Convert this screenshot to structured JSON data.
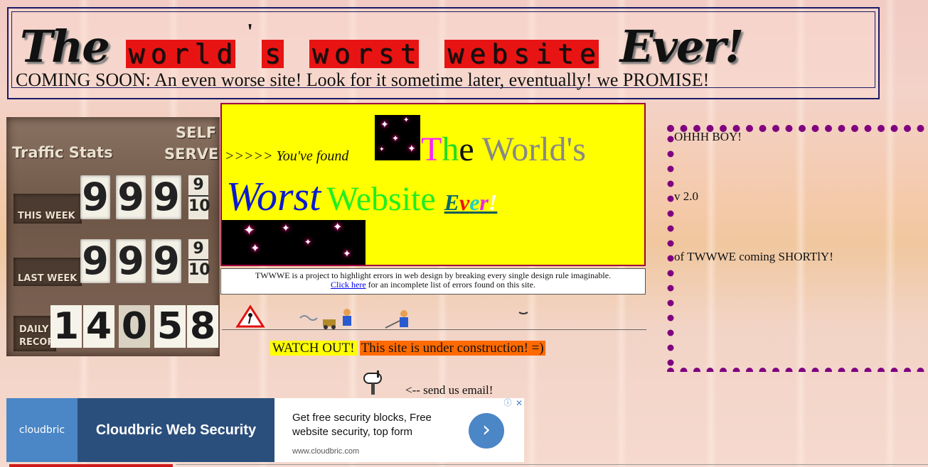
{
  "header": {
    "title_the": "The",
    "title_worlds_letters": [
      "w",
      "o",
      "r",
      "l",
      "d"
    ],
    "title_apostrophe": "'",
    "title_s": "s",
    "title_worst_letters": [
      "w",
      "o",
      "r",
      "s",
      "t"
    ],
    "title_website_letters": [
      "w",
      "e",
      "b",
      "s",
      "i",
      "t",
      "e"
    ],
    "title_ever": "Ever!",
    "coming_soon": "COMING SOON: An even worse site! Look for it sometime later, eventually!  we PROMISE!"
  },
  "traffic": {
    "title": "Traffic Stats",
    "self": "SELF",
    "serve": "SERVE",
    "this_week_label": "THIS WEEK",
    "this_week_digits": [
      "9",
      "9",
      "9"
    ],
    "last_week_label": "LAST WEEK",
    "last_week_digits": [
      "9",
      "9",
      "9"
    ],
    "frac_top": "9",
    "frac_bottom": "10",
    "daily_label_1": "DAILY",
    "daily_label_2": "RECOR",
    "daily_digits": [
      "1",
      "4",
      "0",
      "5",
      "8"
    ]
  },
  "banner": {
    "found": ">>>>> You've found",
    "the_letters": [
      {
        "ch": "T",
        "color": "#ff22ff"
      },
      {
        "ch": "h",
        "color": "#22dd22"
      },
      {
        "ch": "e",
        "color": "#111111"
      }
    ],
    "worlds": " World's",
    "worlds_color": "#888888",
    "worst": "Worst",
    "website": "Website",
    "ever_letters": [
      {
        "ch": "E",
        "color": "#0a6a6a"
      },
      {
        "ch": "v",
        "color": "#ee1111"
      },
      {
        "ch": "e",
        "color": "#22cccc"
      },
      {
        "ch": "r",
        "color": "#ee22ee"
      },
      {
        "ch": "!",
        "color": "#ffffff"
      }
    ]
  },
  "info": {
    "line1": "TWWWE is a project to highlight errors in web design by breaking every single design rule imaginable.",
    "link": "Click here",
    "line2_rest": " for an incomplete list of errors found on this site."
  },
  "construction": {
    "watch_out": "WATCH OUT!",
    "under": "This site is under construction! =)"
  },
  "email": {
    "text": "<-- send us email!"
  },
  "right": {
    "line1": "OHHH BOY!",
    "line2": "v 2.0",
    "line3": "of TWWWE coming SHORTlY!",
    "dot_color": "#800080"
  },
  "ad": {
    "logo": "cloudbric",
    "name": "Cloudbric Web Security",
    "copy": "Get free security blocks, Free website security, top form",
    "url": "www.cloudbric.com",
    "go_icon": "›",
    "close_icon": "✕",
    "info_icon": "ⓘ"
  }
}
